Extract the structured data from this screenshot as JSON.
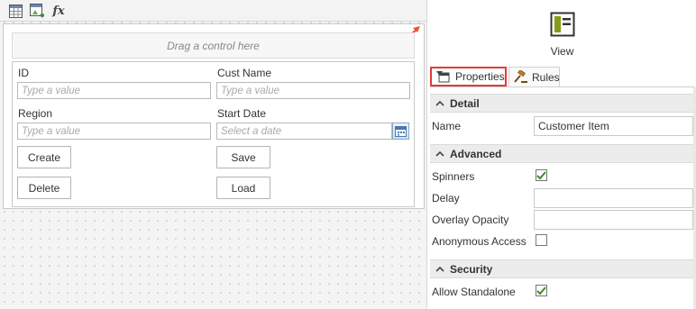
{
  "toolbar": {
    "buttons": [
      {
        "icon": "table-icon"
      },
      {
        "icon": "layout-image-icon"
      },
      {
        "icon": "fx-icon",
        "label": "fx"
      }
    ]
  },
  "canvas": {
    "drop_hint": "Drag a control here",
    "fields": {
      "id": {
        "label": "ID",
        "placeholder": "Type a value"
      },
      "cust_name": {
        "label": "Cust Name",
        "placeholder": "Type a value"
      },
      "region": {
        "label": "Region",
        "placeholder": "Type a value"
      },
      "start_date": {
        "label": "Start Date",
        "placeholder": "Select a date"
      }
    },
    "buttons": {
      "create": "Create",
      "save": "Save",
      "delete": "Delete",
      "load": "Load"
    }
  },
  "panel": {
    "view_label": "View",
    "tabs": {
      "properties": "Properties",
      "rules": "Rules"
    },
    "sections": {
      "detail": {
        "title": "Detail",
        "name_label": "Name",
        "name_value": "Customer Item"
      },
      "advanced": {
        "title": "Advanced",
        "spinners_label": "Spinners",
        "spinners_checked": true,
        "delay_label": "Delay",
        "delay_value": "",
        "overlay_label": "Overlay Opacity",
        "overlay_value": "",
        "anonymous_label": "Anonymous Access",
        "anonymous_checked": false
      },
      "security": {
        "title": "Security",
        "standalone_label": "Allow Standalone",
        "standalone_checked": true
      }
    }
  },
  "colors": {
    "highlight_border": "#e23a3a",
    "arrow": "#e8572a",
    "check": "#3a8a2a",
    "view_icon": "#8a9a1a"
  }
}
